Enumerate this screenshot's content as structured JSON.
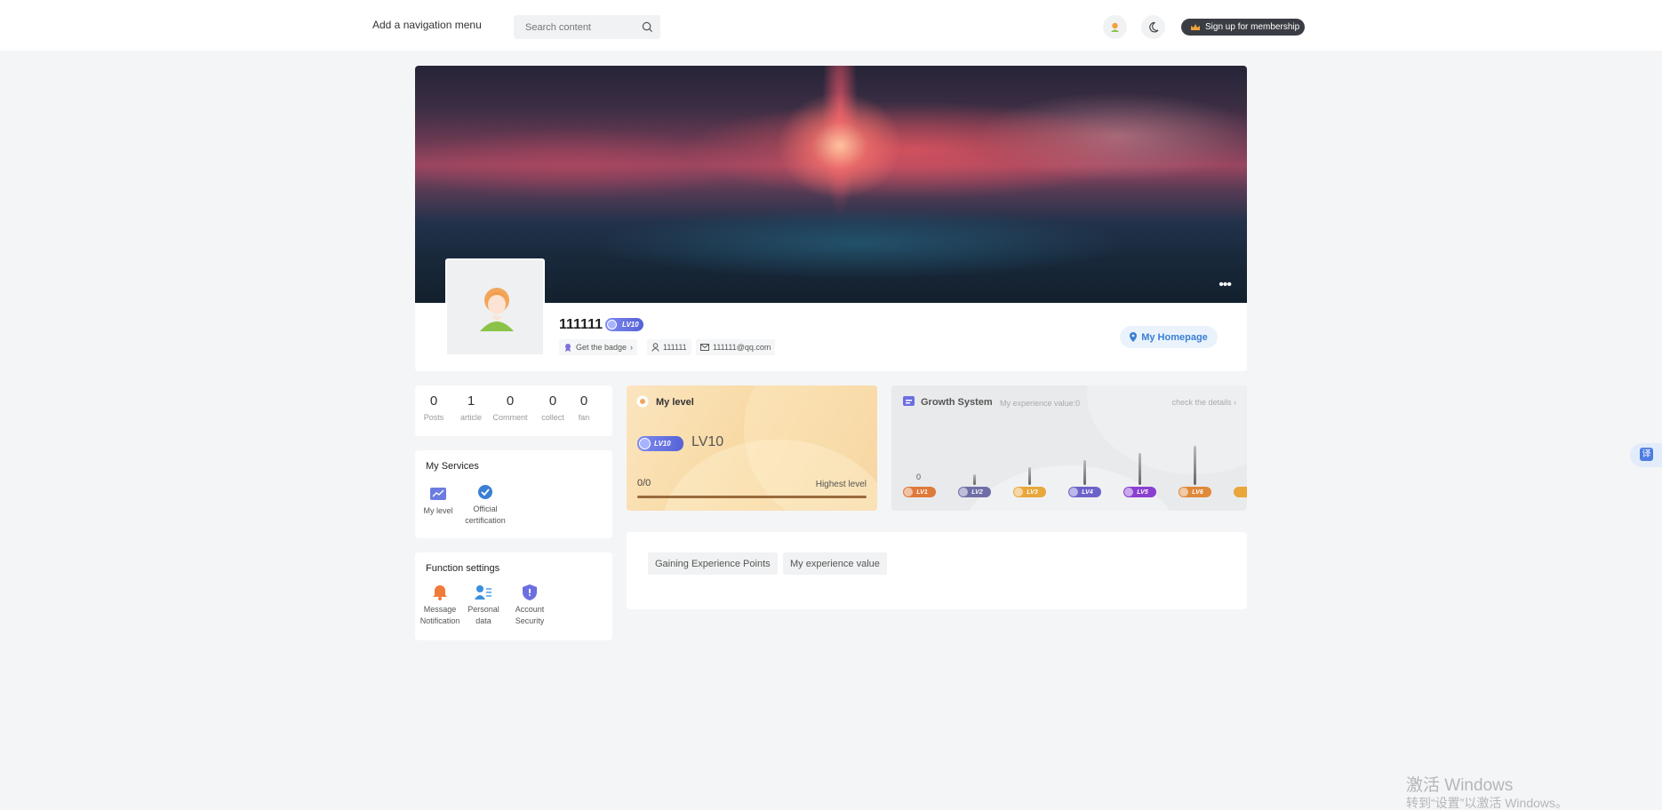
{
  "header": {
    "nav_menu_label": "Add a navigation menu",
    "search_placeholder": "Search content",
    "membership_button": "Sign up for membership"
  },
  "profile": {
    "username": "111111",
    "level_badge": "LV10",
    "badge_link": "Get the badge",
    "user_id": "111111",
    "email": "111111@qq.com",
    "homepage_button": "My Homepage"
  },
  "stats": [
    {
      "value": "0",
      "label": "Posts"
    },
    {
      "value": "1",
      "label": "article"
    },
    {
      "value": "0",
      "label": "Comment"
    },
    {
      "value": "0",
      "label": "collect"
    },
    {
      "value": "0",
      "label": "fan"
    }
  ],
  "services": {
    "title": "My Services",
    "items": [
      {
        "label": "My level",
        "icon": "level-chart-icon"
      },
      {
        "label": "Official certification",
        "icon": "verified-badge-icon"
      }
    ]
  },
  "function_settings": {
    "title": "Function settings",
    "items": [
      {
        "label": "Message Notification",
        "icon": "bell-icon"
      },
      {
        "label": "Personal data",
        "icon": "personal-data-icon"
      },
      {
        "label": "Account Security",
        "icon": "shield-icon"
      }
    ]
  },
  "my_level": {
    "title": "My level",
    "badge": "LV10",
    "level_text": "LV10",
    "progress_text": "0/0",
    "status": "Highest level",
    "progress_fraction": 1.0
  },
  "growth": {
    "title": "Growth System",
    "experience": "My experience value:0",
    "details_link": "check the details",
    "current_value": "0",
    "levels": [
      {
        "label": "LV1",
        "color": "#e07a3a"
      },
      {
        "label": "LV2",
        "color": "#6f6fa8"
      },
      {
        "label": "LV3",
        "color": "#e9a63a"
      },
      {
        "label": "LV4",
        "color": "#6b63c9"
      },
      {
        "label": "LV5",
        "color": "#8a3fd1"
      },
      {
        "label": "LV6",
        "color": "#e0893a"
      }
    ]
  },
  "experience_tabs": [
    "Gaining Experience Points",
    "My experience value"
  ],
  "translate_button": "译",
  "watermark": {
    "line1": "激活 Windows",
    "line2": "转到“设置”以激活 Windows。"
  }
}
